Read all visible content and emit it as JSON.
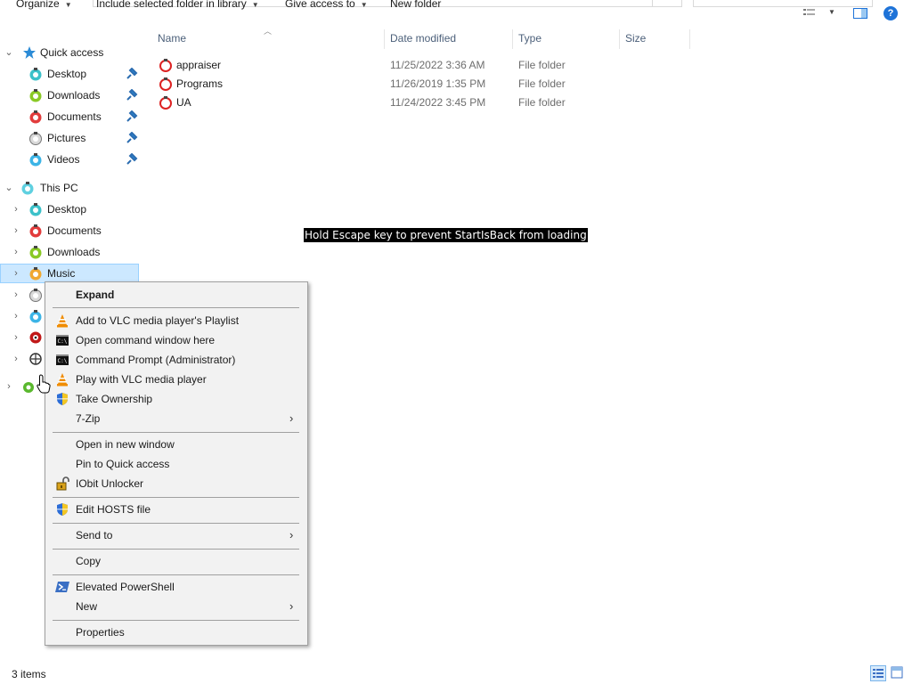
{
  "toolbar": {
    "organize": "Organize",
    "include_library": "Include selected folder in library",
    "give_access": "Give access to",
    "new_folder": "New folder"
  },
  "nav": {
    "quick_access": {
      "label": "Quick access",
      "items": [
        "Desktop",
        "Downloads",
        "Documents",
        "Pictures",
        "Videos"
      ]
    },
    "this_pc": {
      "label": "This PC",
      "items": [
        "Desktop",
        "Documents",
        "Downloads",
        "Music"
      ]
    },
    "selected": "Music"
  },
  "columns": {
    "name": "Name",
    "date": "Date modified",
    "type": "Type",
    "size": "Size"
  },
  "files": [
    {
      "name": "appraiser",
      "date": "11/25/2022 3:36 AM",
      "type": "File folder"
    },
    {
      "name": "Programs",
      "date": "11/26/2019 1:35 PM",
      "type": "File folder"
    },
    {
      "name": "UA",
      "date": "11/24/2022 3:45 PM",
      "type": "File folder"
    }
  ],
  "banner": "Hold Escape key to prevent StartIsBack from loading",
  "context_menu": {
    "expand": "Expand",
    "vlc_playlist": "Add to VLC media player's Playlist",
    "open_cmd": "Open command window here",
    "cmd_admin": "Command Prompt (Administrator)",
    "vlc_play": "Play with VLC media player",
    "take_ownership": "Take Ownership",
    "seven_zip": "7-Zip",
    "open_new_window": "Open in new window",
    "pin_quick": "Pin to Quick access",
    "iobit": "IObit Unlocker",
    "edit_hosts": "Edit HOSTS file",
    "send_to": "Send to",
    "copy": "Copy",
    "powershell": "Elevated PowerShell",
    "new": "New",
    "properties": "Properties"
  },
  "status": {
    "item_count": "3 items"
  },
  "colors": {
    "selection": "#cce8ff",
    "selection_border": "#99d1ff",
    "menu_bg": "#f2f2f2",
    "header_text": "#4c607a",
    "accent": "#1e73d8"
  }
}
